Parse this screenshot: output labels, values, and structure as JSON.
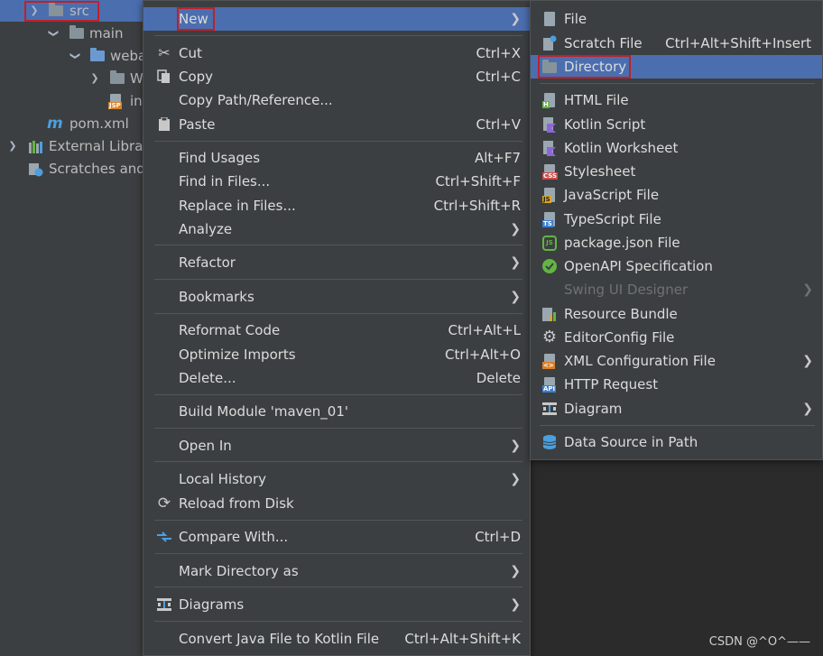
{
  "project_tree": {
    "rows": [
      {
        "label": "src",
        "arrow": "expanded",
        "icon": "folder-icon"
      },
      {
        "label": "main",
        "arrow": "expanded",
        "icon": "folder-icon"
      },
      {
        "label": "weba",
        "arrow": "expanded",
        "icon": "web-folder-icon"
      },
      {
        "label": "W",
        "arrow": "collapsed",
        "icon": "folder-icon"
      },
      {
        "label": "in",
        "arrow": "none",
        "icon": "jsp-file-icon"
      },
      {
        "label": "pom.xml",
        "arrow": "none",
        "icon": "maven-icon"
      },
      {
        "label": "External Librar",
        "arrow": "collapsed",
        "icon": "libraries-icon"
      },
      {
        "label": "Scratches and",
        "arrow": "none",
        "icon": "scratches-icon"
      }
    ],
    "jsp_tag": "JSP",
    "maven_glyph": "m"
  },
  "context_menu": {
    "new": {
      "label": "New"
    },
    "cut": {
      "label": "Cut",
      "shortcut": "Ctrl+X"
    },
    "copy": {
      "label": "Copy",
      "shortcut": "Ctrl+C"
    },
    "copy_path": {
      "label": "Copy Path/Reference..."
    },
    "paste": {
      "label": "Paste",
      "shortcut": "Ctrl+V"
    },
    "find_usages": {
      "label": "Find Usages",
      "shortcut": "Alt+F7"
    },
    "find_in_files": {
      "label": "Find in Files...",
      "shortcut": "Ctrl+Shift+F"
    },
    "replace_in_files": {
      "label": "Replace in Files...",
      "shortcut": "Ctrl+Shift+R"
    },
    "analyze": {
      "label": "Analyze"
    },
    "refactor": {
      "label": "Refactor"
    },
    "bookmarks": {
      "label": "Bookmarks"
    },
    "reformat": {
      "label": "Reformat Code",
      "shortcut": "Ctrl+Alt+L"
    },
    "optimize_imports": {
      "label": "Optimize Imports",
      "shortcut": "Ctrl+Alt+O"
    },
    "delete": {
      "label": "Delete...",
      "shortcut": "Delete"
    },
    "build_module": {
      "label": "Build Module 'maven_01'"
    },
    "open_in": {
      "label": "Open In"
    },
    "local_history": {
      "label": "Local History"
    },
    "reload": {
      "label": "Reload from Disk"
    },
    "compare_with": {
      "label": "Compare With...",
      "shortcut": "Ctrl+D"
    },
    "mark_directory": {
      "label": "Mark Directory as"
    },
    "diagrams": {
      "label": "Diagrams"
    },
    "convert_kotlin": {
      "label": "Convert Java File to Kotlin File",
      "shortcut": "Ctrl+Alt+Shift+K"
    }
  },
  "new_submenu": {
    "file": {
      "label": "File"
    },
    "scratch_file": {
      "label": "Scratch File",
      "shortcut": "Ctrl+Alt+Shift+Insert"
    },
    "directory": {
      "label": "Directory"
    },
    "html_file": {
      "label": "HTML File",
      "tag": "H"
    },
    "kotlin_script": {
      "label": "Kotlin Script"
    },
    "kotlin_worksheet": {
      "label": "Kotlin Worksheet"
    },
    "stylesheet": {
      "label": "Stylesheet",
      "tag": "CSS"
    },
    "javascript_file": {
      "label": "JavaScript File",
      "tag": "JS"
    },
    "typescript_file": {
      "label": "TypeScript File",
      "tag": "TS"
    },
    "package_json": {
      "label": "package.json File",
      "glyph": "JS"
    },
    "openapi": {
      "label": "OpenAPI Specification"
    },
    "swing_ui": {
      "label": "Swing UI Designer",
      "disabled": true
    },
    "resource_bundle": {
      "label": "Resource Bundle"
    },
    "editorconfig": {
      "label": "EditorConfig File"
    },
    "xml_config": {
      "label": "XML Configuration File",
      "tag": "<>"
    },
    "http_request": {
      "label": "HTTP Request",
      "tag": "API"
    },
    "diagram": {
      "label": "Diagram"
    },
    "data_source": {
      "label": "Data Source in Path"
    }
  },
  "watermark": "CSDN @^O^——",
  "colors": {
    "menu_bg": "#3c3f41",
    "highlight": "#4b6eaf",
    "annotation_red": "#c0202a",
    "editor_bg": "#2b2b2b"
  }
}
